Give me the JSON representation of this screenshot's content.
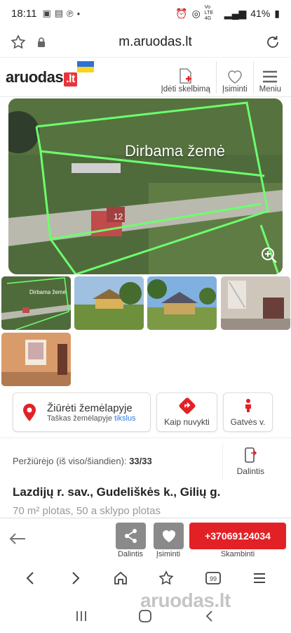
{
  "status": {
    "time": "18:11",
    "signal_label": "Vo LTE 4G",
    "battery": "41%"
  },
  "browser": {
    "url": "m.aruodas.lt"
  },
  "header": {
    "logo_main": "aruodas",
    "logo_suffix": ".lt",
    "actions": [
      {
        "label": "Įdėti skelbimą",
        "icon": "add-listing-icon"
      },
      {
        "label": "Įsiminti",
        "icon": "heart-icon"
      },
      {
        "label": "Meniu",
        "icon": "hamburger-menu-icon"
      }
    ]
  },
  "photo": {
    "overlay_label": "Dirbama žemė",
    "plot_number": "12",
    "thumb_label": "Dirbama žemė"
  },
  "map_actions": {
    "view_map_title": "Žiūrėti žemėlapyje",
    "view_map_sub_prefix": "Taškas žemėlapyje",
    "view_map_sub_value": "tikslus",
    "directions": "Kaip nuvykti",
    "street_view": "Gatvės v."
  },
  "stats": {
    "views_label": "Peržiūrėjo (iš viso/šiandien):",
    "views_value": "33/33",
    "share_label": "Dalintis"
  },
  "listing": {
    "address": "Lazdijų r. sav., Gudeliškės k., Gilių g.",
    "subinfo": "70 m² plotas, 50 a sklypo plotas"
  },
  "bottom_bar": {
    "share": "Dalintis",
    "save": "Įsiminti",
    "phone": "+37069124034",
    "call": "Skambinti"
  },
  "watermark": "aruodas.lt",
  "colors": {
    "brand_red": "#e22127",
    "link_blue": "#2b7de9",
    "flag_blue": "#2f6fd6",
    "flag_yellow": "#f7d51c"
  }
}
